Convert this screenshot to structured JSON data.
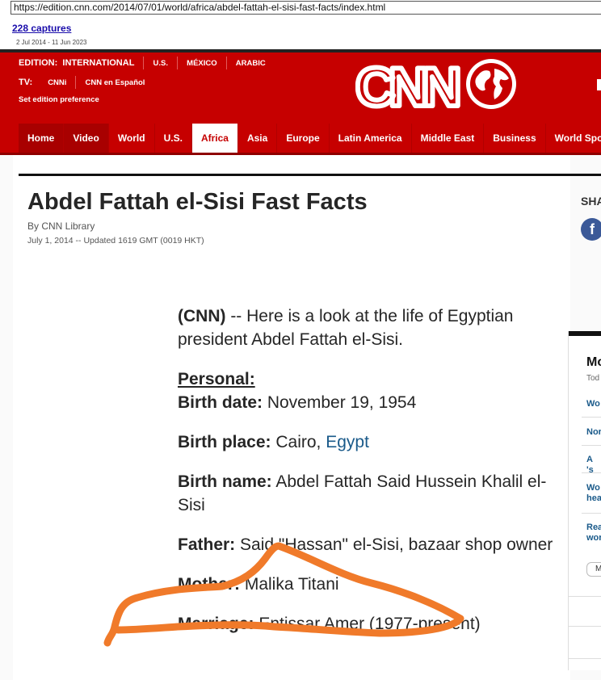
{
  "wayback": {
    "url": "https://edition.cnn.com/2014/07/01/world/africa/abdel-fattah-el-sisi-fast-facts/index.html",
    "captures": "228 captures",
    "range": "2 Jul 2014 - 11 Jun 2023"
  },
  "header": {
    "edition_label": "EDITION:",
    "edition_value": "INTERNATIONAL",
    "editions": [
      "U.S.",
      "MÉXICO",
      "ARABIC"
    ],
    "tv_label": "TV:",
    "tv_channels": [
      "CNNi",
      "CNN en Español"
    ],
    "set_pref": "Set edition preference",
    "logo_text": "CNN",
    "brand_color": "#c60000"
  },
  "nav": {
    "items": [
      "Home",
      "Video",
      "World",
      "U.S.",
      "Africa",
      "Asia",
      "Europe",
      "Latin America",
      "Middle East",
      "Business",
      "World Sport"
    ],
    "active": "Africa"
  },
  "article": {
    "title": "Abdel Fattah el-Sisi Fast Facts",
    "byline": "By CNN Library",
    "dateline": "July 1, 2014 -- Updated 1619 GMT (0019 HKT)",
    "share": "SHA",
    "intro_source": "(CNN)",
    "intro_text": " -- Here is a look at the life of Egyptian president Abdel Fattah el-Sisi.",
    "personal_heading": "Personal:",
    "birth_date_label": "Birth date:",
    "birth_date": " November 19, 1954",
    "birth_place_label": "Birth place:",
    "birth_place_city": " Cairo, ",
    "birth_place_country": "Egypt",
    "birth_name_label": "Birth name:",
    "birth_name": " Abdel Fattah Said Hussein Khalil el-Sisi",
    "father_label": "Father:",
    "father": " Said \"Hassan\" el-Sisi, bazaar shop owner",
    "mother_label": "Mother:",
    "mother": " Malika Titani",
    "marriage_label": "Marriage:",
    "marriage": " Entissar Amer (1977-present)",
    "link_color": "#1a5a8a"
  },
  "right_panel": {
    "heading": "Mo",
    "sub": "Tod",
    "links": [
      "Wo",
      "Nor",
      "A 's",
      "Wo hea",
      "Rea wor"
    ],
    "button": "M"
  },
  "annotation": {
    "stroke_color": "#f07a2a"
  }
}
